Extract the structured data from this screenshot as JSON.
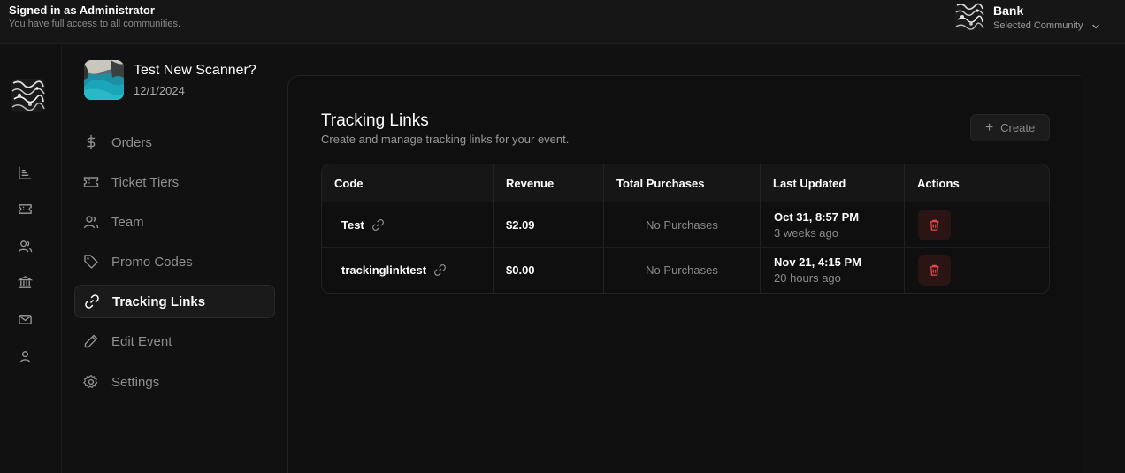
{
  "header": {
    "admin_title": "Signed in as Administrator",
    "admin_subtitle": "You have full access to all communities.",
    "community_name": "Bank",
    "community_label": "Selected Community"
  },
  "rail": {
    "icons": [
      "chart-icon",
      "ticket-icon",
      "users-icon",
      "bank-icon",
      "mail-icon",
      "user-icon"
    ]
  },
  "event": {
    "name": "Test New Scanner?",
    "date": "12/1/2024"
  },
  "nav": {
    "items": [
      {
        "label": "Orders",
        "icon": "dollar-icon"
      },
      {
        "label": "Ticket Tiers",
        "icon": "ticket-icon"
      },
      {
        "label": "Team",
        "icon": "users-icon"
      },
      {
        "label": "Promo Codes",
        "icon": "tag-icon"
      },
      {
        "label": "Tracking Links",
        "icon": "link-icon",
        "active": true
      },
      {
        "label": "Edit Event",
        "icon": "pencil-icon"
      },
      {
        "label": "Settings",
        "icon": "gear-icon"
      }
    ]
  },
  "main": {
    "title": "Tracking Links",
    "subtitle": "Create and manage tracking links for your event.",
    "create_label": "Create",
    "columns": [
      "Code",
      "Revenue",
      "Total Purchases",
      "Last Updated",
      "Actions"
    ],
    "rows": [
      {
        "code": "Test",
        "revenue": "$2.09",
        "purchases": "No Purchases",
        "updated": "Oct 31, 8:57 PM",
        "ago": "3 weeks ago"
      },
      {
        "code": "trackinglinktest",
        "revenue": "$0.00",
        "purchases": "No Purchases",
        "updated": "Nov 21, 4:15 PM",
        "ago": "20 hours ago"
      }
    ]
  },
  "colors": {
    "background": "#111111",
    "danger": "#e5484d",
    "danger_bg": "#2a1414"
  }
}
